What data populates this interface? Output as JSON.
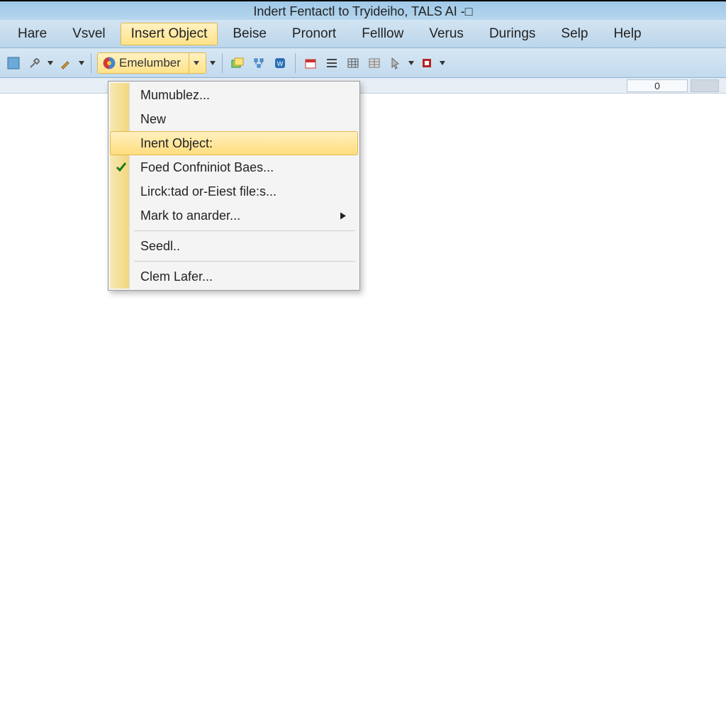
{
  "title": "Indert Fentactl to Tryideiho, TALS AI  -□",
  "menubar": {
    "items": [
      {
        "label": "Hare"
      },
      {
        "label": "Vsvel"
      },
      {
        "label": "Insert Object",
        "active": true
      },
      {
        "label": "Beise"
      },
      {
        "label": "Pronort"
      },
      {
        "label": "Felllow"
      },
      {
        "label": "Verus"
      },
      {
        "label": "Durings"
      },
      {
        "label": "Selp"
      },
      {
        "label": "Help"
      }
    ]
  },
  "toolbar": {
    "combo_label": "Emelumber"
  },
  "status": {
    "value": "0"
  },
  "dropdown": {
    "items": [
      {
        "label": "Mumublez..."
      },
      {
        "label": "New"
      },
      {
        "label": "Inent Object:",
        "highlight": true
      },
      {
        "label": "Foed Confniniot Baes...",
        "checked": true
      },
      {
        "label": "Lirck:tad or-Eiest file:s..."
      },
      {
        "label": "Mark to anarder...",
        "submenu": true
      },
      {
        "sep": true
      },
      {
        "label": "Seedl.."
      },
      {
        "sep": true
      },
      {
        "label": "Clem Lafer..."
      }
    ]
  }
}
